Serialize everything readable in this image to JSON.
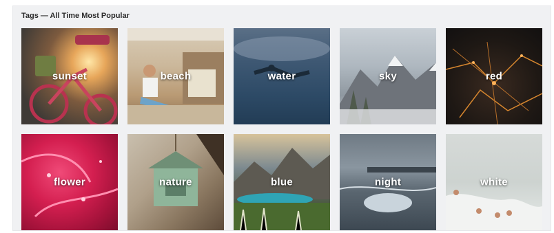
{
  "header": {
    "title": "Tags — All Time Most Popular"
  },
  "tags": [
    {
      "label": "sunset"
    },
    {
      "label": "beach"
    },
    {
      "label": "water"
    },
    {
      "label": "sky"
    },
    {
      "label": "red"
    },
    {
      "label": "flower"
    },
    {
      "label": "nature"
    },
    {
      "label": "blue"
    },
    {
      "label": "night"
    },
    {
      "label": "white"
    }
  ]
}
